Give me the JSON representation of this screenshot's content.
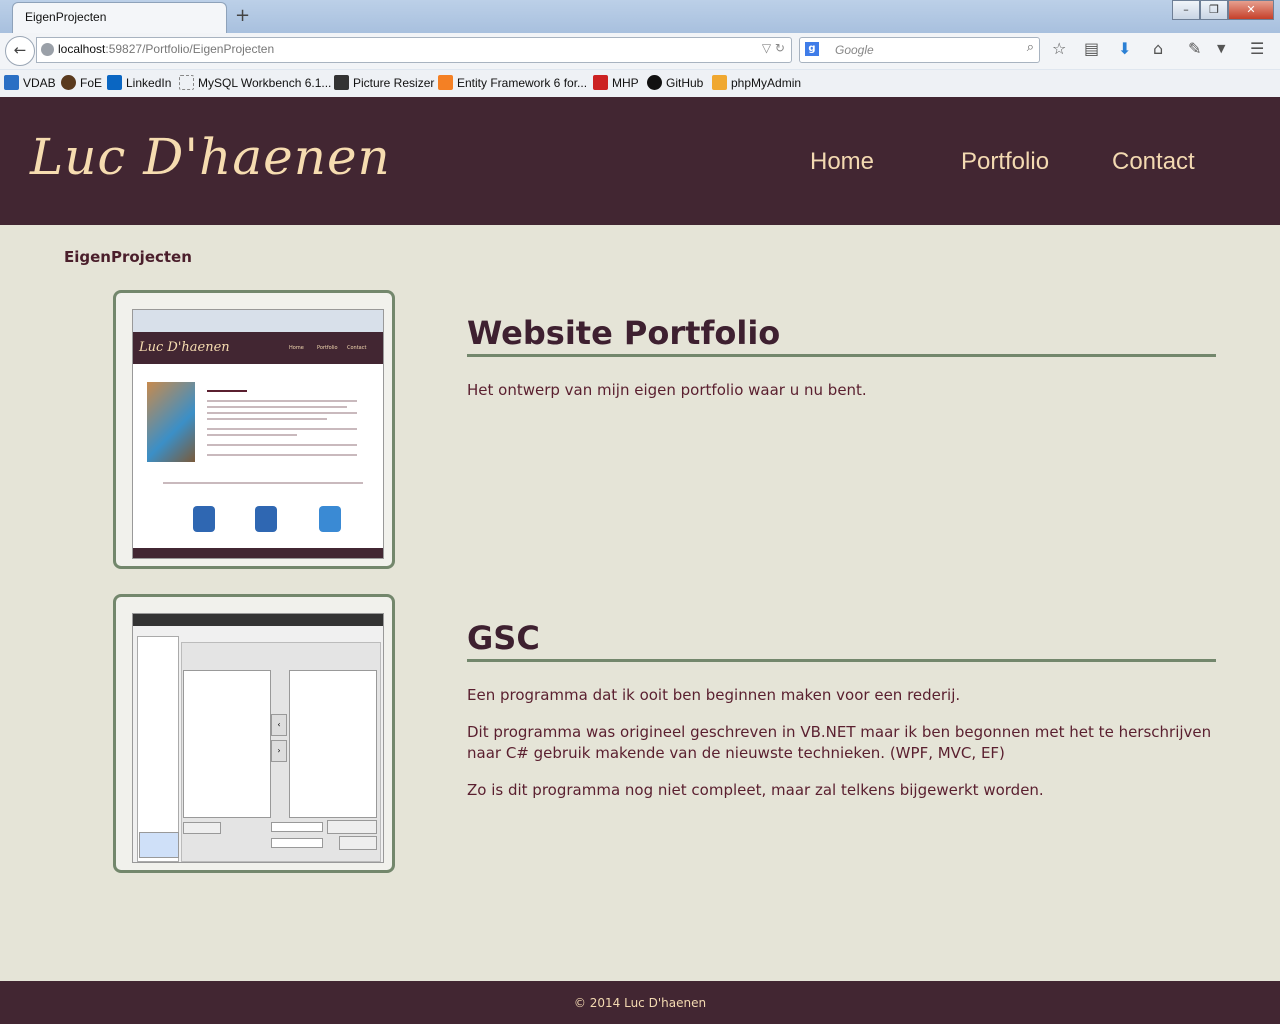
{
  "browser": {
    "tab_title": "EigenProjecten",
    "new_tab": "+",
    "url_host": "localhost",
    "url_rest": ":59827/Portfolio/EigenProjecten",
    "search_engine_icon": "g",
    "search_placeholder": "Google",
    "bookmarks": [
      "VDAB",
      "FoE",
      "LinkedIn",
      "MySQL Workbench 6.1...",
      "Picture Resizer",
      "Entity Framework 6 for...",
      "MHP",
      "GitHub",
      "phpMyAdmin"
    ]
  },
  "site": {
    "logo": "Luc D'haenen",
    "nav": {
      "home": "Home",
      "portfolio": "Portfolio",
      "contact": "Contact"
    },
    "page_label": "EigenProjecten",
    "footer": "© 2014 Luc D'haenen"
  },
  "projects": [
    {
      "title": "Website Portfolio",
      "paragraphs": [
        "Het ontwerp van mijn eigen portfolio waar u nu bent."
      ]
    },
    {
      "title": "GSC",
      "paragraphs": [
        "Een programma dat ik ooit ben beginnen maken voor een rederij.",
        "Dit programma was origineel geschreven in VB.NET maar ik ben begonnen met het te herschrijven naar C# gebruik makende van de nieuwste technieken. (WPF, MVC, EF)",
        "Zo is dit programma nog niet compleet, maar zal telkens bijgewerkt worden."
      ]
    }
  ],
  "colors": {
    "header_bg": "#422632",
    "accent": "#73876c",
    "text": "#5a1f2f",
    "page_bg": "#e5e4d7"
  }
}
